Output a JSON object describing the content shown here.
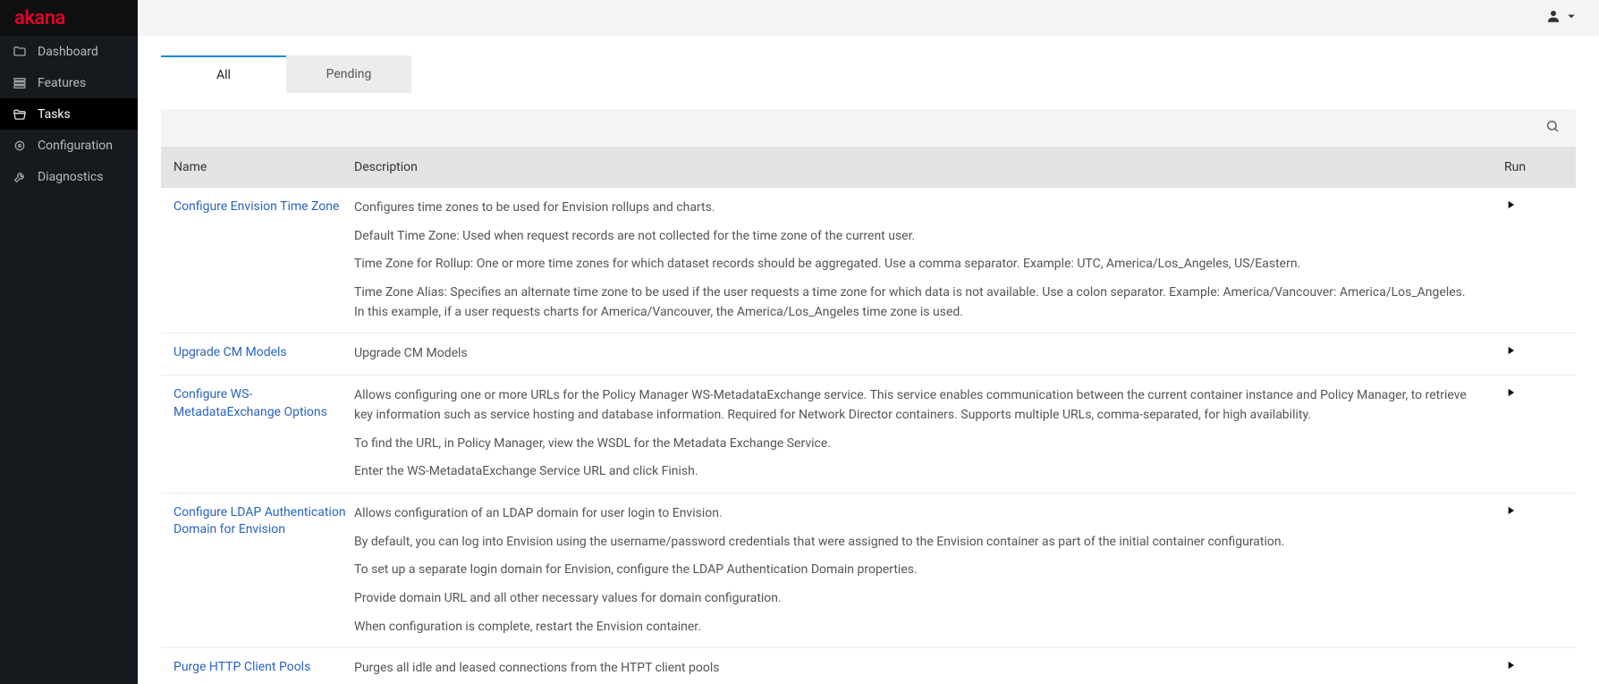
{
  "brand": "akana",
  "sidebar": {
    "items": [
      {
        "label": "Dashboard",
        "key": "dashboard",
        "active": false
      },
      {
        "label": "Features",
        "key": "features",
        "active": false
      },
      {
        "label": "Tasks",
        "key": "tasks",
        "active": true
      },
      {
        "label": "Configuration",
        "key": "configuration",
        "active": false
      },
      {
        "label": "Diagnostics",
        "key": "diagnostics",
        "active": false
      }
    ]
  },
  "tabs": [
    {
      "label": "All",
      "active": true
    },
    {
      "label": "Pending",
      "active": false
    }
  ],
  "columns": {
    "name": "Name",
    "description": "Description",
    "run": "Run"
  },
  "tasks": [
    {
      "name": "Configure Envision Time Zone",
      "paragraphs": [
        "Configures time zones to be used for Envision rollups and charts.",
        "Default Time Zone: Used when request records are not collected for the time zone of the current user.",
        "Time Zone for Rollup: One or more time zones for which dataset records should be aggregated. Use a comma separator. Example: UTC, America/Los_Angeles, US/Eastern.",
        "Time Zone Alias: Specifies an alternate time zone to be used if the user requests a time zone for which data is not available. Use a colon separator. Example: America/Vancouver: America/Los_Angeles. In this example, if a user requests charts for America/Vancouver, the America/Los_Angeles time zone is used."
      ]
    },
    {
      "name": "Upgrade CM Models",
      "paragraphs": [
        "Upgrade CM Models"
      ]
    },
    {
      "name": "Configure WS-MetadataExchange Options",
      "paragraphs": [
        "Allows configuring one or more URLs for the Policy Manager WS-MetadataExchange service. This service enables communication between the current container instance and Policy Manager, to retrieve key information such as service hosting and database information. Required for Network Director containers. Supports multiple URLs, comma-separated, for high availability.",
        "To find the URL, in Policy Manager, view the WSDL for the Metadata Exchange Service.",
        "Enter the WS-MetadataExchange Service URL and click Finish."
      ]
    },
    {
      "name": "Configure LDAP Authentication Domain for Envision",
      "paragraphs": [
        "Allows configuration of an LDAP domain for user login to Envision.",
        "By default, you can log into Envision using the username/password credentials that were assigned to the Envision container as part of the initial container configuration.",
        "To set up a separate login domain for Envision, configure the LDAP Authentication Domain properties.",
        "Provide domain URL and all other necessary values for domain configuration.",
        "When configuration is complete, restart the Envision container."
      ]
    },
    {
      "name": "Purge HTTP Client Pools",
      "paragraphs": [
        "Purges all idle and leased connections from the HTPT client pools"
      ]
    }
  ]
}
